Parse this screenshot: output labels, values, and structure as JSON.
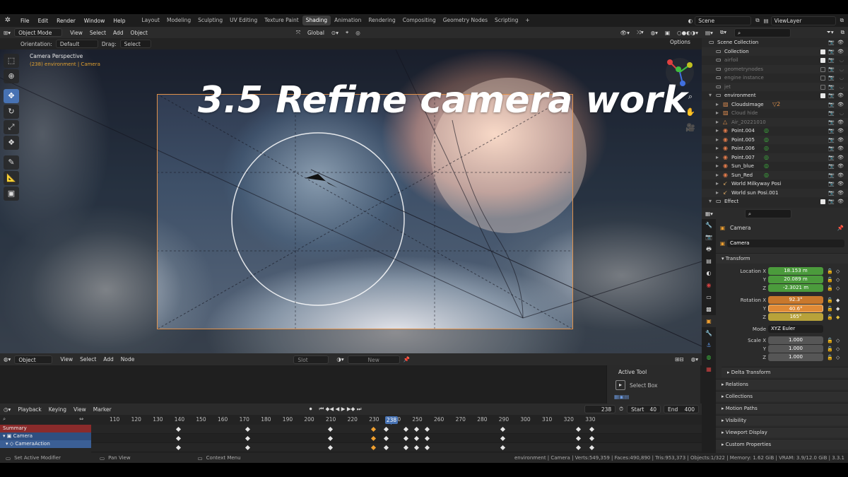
{
  "menu": {
    "items": [
      "File",
      "Edit",
      "Render",
      "Window",
      "Help"
    ],
    "workspaces": [
      "Layout",
      "Modeling",
      "Sculpting",
      "UV Editing",
      "Texture Paint",
      "Shading",
      "Animation",
      "Rendering",
      "Compositing",
      "Geometry Nodes",
      "Scripting"
    ],
    "active_workspace": "Shading",
    "add_tab": "+",
    "scene": "Scene",
    "view_layer": "ViewLayer"
  },
  "viewport_header": {
    "mode": "Object Mode",
    "menus": [
      "View",
      "Select",
      "Add",
      "Object"
    ],
    "transform_orientation": "Global",
    "orientation_label": "Orientation:",
    "orientation_value": "Default",
    "drag_label": "Drag:",
    "drag_value": "Select Box",
    "options": "Options"
  },
  "viewport": {
    "title_overlay": "3.5 Refine camera work",
    "perspective": "Camera Perspective",
    "subtitle": "(238) environment | Camera"
  },
  "tools": {
    "items": [
      "select-box",
      "cursor",
      "move",
      "rotate",
      "scale",
      "transform",
      "annotate",
      "measure",
      "add-cube"
    ],
    "active": "move"
  },
  "shader_header": {
    "type": "Object",
    "menus": [
      "View",
      "Select",
      "Add",
      "Node"
    ],
    "slot": "Slot",
    "new_label": "New"
  },
  "active_tool_panel": {
    "title": "Active Tool",
    "tool": "Select Box"
  },
  "timeline": {
    "menus": [
      "Playback",
      "Keying",
      "View",
      "Marker"
    ],
    "current_frame": "238",
    "start_label": "Start",
    "start": "40",
    "end_label": "End",
    "end": "400",
    "ticks": [
      "110",
      "120",
      "130",
      "140",
      "150",
      "160",
      "170",
      "180",
      "190",
      "200",
      "210",
      "220",
      "230",
      "240",
      "250",
      "260",
      "270",
      "280",
      "290",
      "300",
      "310",
      "320",
      "330"
    ],
    "channels": [
      "Summary",
      "Camera",
      "CameraAction"
    ],
    "keyframes": [
      140,
      172,
      210,
      230,
      236,
      245,
      250,
      255,
      290,
      325,
      331
    ],
    "selected_keyframes": [
      230
    ]
  },
  "statusbar": {
    "left1": "Set Active Modifier",
    "left2": "Pan View",
    "left3": "Context Menu",
    "stats": "environment | Camera | Verts:549,359 | Faces:490,890 | Tris:953,373 | Objects:1/322 | Memory: 1.62 GiB | VRAM: 3.9/12.0 GiB | 3.3.1"
  },
  "outliner": {
    "rows": [
      {
        "label": "Scene Collection",
        "indent": 0,
        "icon": "collection-icon",
        "dim": false,
        "check": false,
        "hidden": false
      },
      {
        "label": "Collection",
        "indent": 1,
        "icon": "collection-icon",
        "dim": false,
        "check": true,
        "hidden": false
      },
      {
        "label": "airfoil",
        "indent": 1,
        "icon": "collection-icon",
        "dim": true,
        "check": true,
        "hidden": true
      },
      {
        "label": "geometrynodes",
        "indent": 1,
        "icon": "collection-icon",
        "dim": true,
        "check": false,
        "hidden": true
      },
      {
        "label": "engine instance",
        "indent": 1,
        "icon": "collection-icon",
        "dim": true,
        "check": false,
        "hidden": true
      },
      {
        "label": "jet",
        "indent": 1,
        "icon": "collection-icon",
        "dim": true,
        "check": false,
        "hidden": true
      },
      {
        "label": "environment",
        "indent": 1,
        "icon": "collection-icon",
        "dim": false,
        "check": true,
        "hidden": false
      },
      {
        "label": "CloudsImage",
        "indent": 2,
        "icon": "image-icon",
        "dim": false,
        "check": true,
        "hidden": false
      },
      {
        "label": "Cloud hide",
        "indent": 2,
        "icon": "image-icon",
        "dim": true,
        "check": false,
        "hidden": true
      },
      {
        "label": "Air_20221010",
        "indent": 2,
        "icon": "mesh-icon",
        "dim": true,
        "check": false,
        "hidden": false
      },
      {
        "label": "Point.004",
        "indent": 2,
        "icon": "light-icon",
        "dim": false,
        "check": false,
        "hidden": false
      },
      {
        "label": "Point.005",
        "indent": 2,
        "icon": "light-icon",
        "dim": false,
        "check": false,
        "hidden": false
      },
      {
        "label": "Point.006",
        "indent": 2,
        "icon": "light-icon",
        "dim": false,
        "check": false,
        "hidden": false
      },
      {
        "label": "Point.007",
        "indent": 2,
        "icon": "light-icon",
        "dim": false,
        "check": false,
        "hidden": false
      },
      {
        "label": "Sun_blue",
        "indent": 2,
        "icon": "light-icon",
        "dim": false,
        "check": false,
        "hidden": false
      },
      {
        "label": "Sun_Red",
        "indent": 2,
        "icon": "light-icon",
        "dim": false,
        "check": false,
        "hidden": false
      },
      {
        "label": "World Milkyway Posi",
        "indent": 2,
        "icon": "empty-icon",
        "dim": false,
        "check": false,
        "hidden": false
      },
      {
        "label": "World sun Posi.001",
        "indent": 2,
        "icon": "empty-icon",
        "dim": false,
        "check": false,
        "hidden": false
      },
      {
        "label": "Effect",
        "indent": 1,
        "icon": "collection-icon",
        "dim": false,
        "check": true,
        "hidden": false
      }
    ],
    "cloud_badge": "2"
  },
  "properties": {
    "object_name": "Camera",
    "data_name": "Camera",
    "transform_label": "Transform",
    "location_label": "Location X",
    "location": [
      "18.153 m",
      "20.089 m",
      "-2.3021 m"
    ],
    "rotation_label": "Rotation X",
    "rotation": [
      "92.3°",
      "40.6°",
      "165°"
    ],
    "axis_labels": [
      "Y",
      "Z"
    ],
    "mode_label": "Mode",
    "mode": "XYZ Euler",
    "scale_label": "Scale X",
    "scale": [
      "1.000",
      "1.000",
      "1.000"
    ],
    "delta": "Delta Transform",
    "panels": [
      "Relations",
      "Collections",
      "Motion Paths",
      "Visibility",
      "Viewport Display",
      "Custom Properties"
    ]
  },
  "colors": {
    "accent_blue": "#4772b3",
    "location_green": "#4b9b3c",
    "rotation_orange": "#c9782c",
    "keyframe_orange": "#f0a030",
    "camera_frame": "#e0914a"
  }
}
